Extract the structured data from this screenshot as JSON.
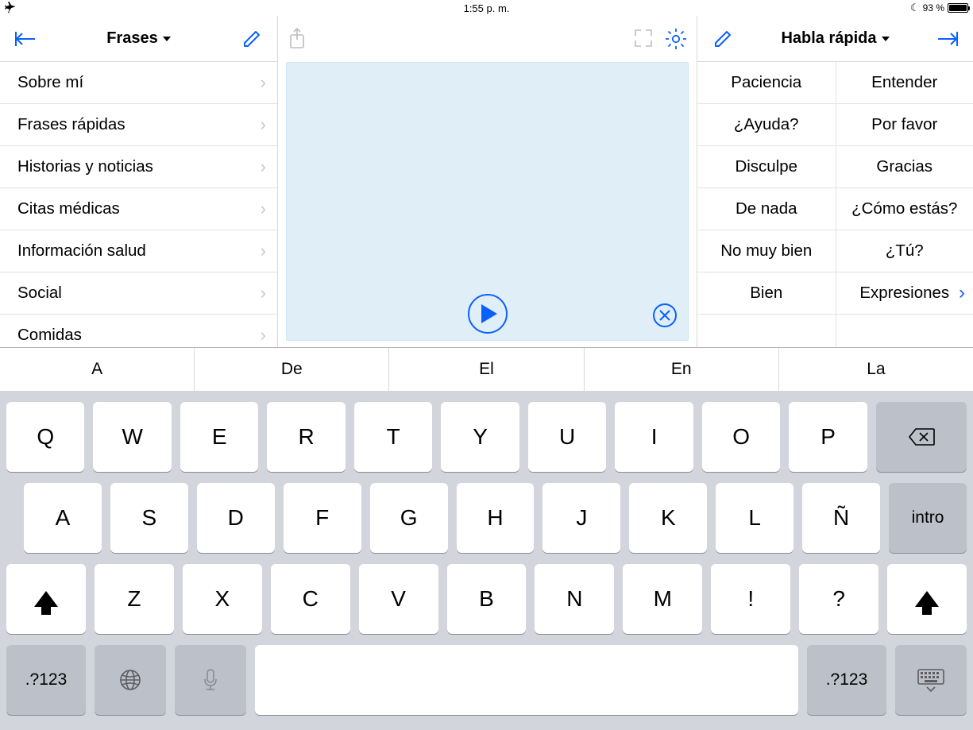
{
  "status": {
    "time": "1:55 p. m.",
    "battery_pct": "93 %",
    "battery_level": 93
  },
  "left": {
    "title": "Frases",
    "items": [
      "Sobre mí",
      "Frases rápidas",
      "Historias y noticias",
      "Citas médicas",
      "Información salud",
      "Social",
      "Comidas"
    ]
  },
  "right": {
    "title": "Habla rápida",
    "cells": [
      [
        "Paciencia",
        "Entender"
      ],
      [
        "¿Ayuda?",
        "Por favor"
      ],
      [
        "Disculpe",
        "Gracias"
      ],
      [
        "De nada",
        "¿Cómo estás?"
      ],
      [
        "No muy bien",
        "¿Tú?"
      ],
      [
        "Bien",
        "Expresiones"
      ]
    ],
    "last_has_chevron": true
  },
  "suggestions": [
    "A",
    "De",
    "El",
    "En",
    "La"
  ],
  "keyboard": {
    "row1": [
      "Q",
      "W",
      "E",
      "R",
      "T",
      "Y",
      "U",
      "I",
      "O",
      "P"
    ],
    "row2": [
      "A",
      "S",
      "D",
      "F",
      "G",
      "H",
      "J",
      "K",
      "L",
      "Ñ"
    ],
    "row3": [
      "Z",
      "X",
      "C",
      "V",
      "B",
      "N",
      "M",
      "!",
      "?"
    ],
    "enter": "intro",
    "sym": ".?123"
  }
}
